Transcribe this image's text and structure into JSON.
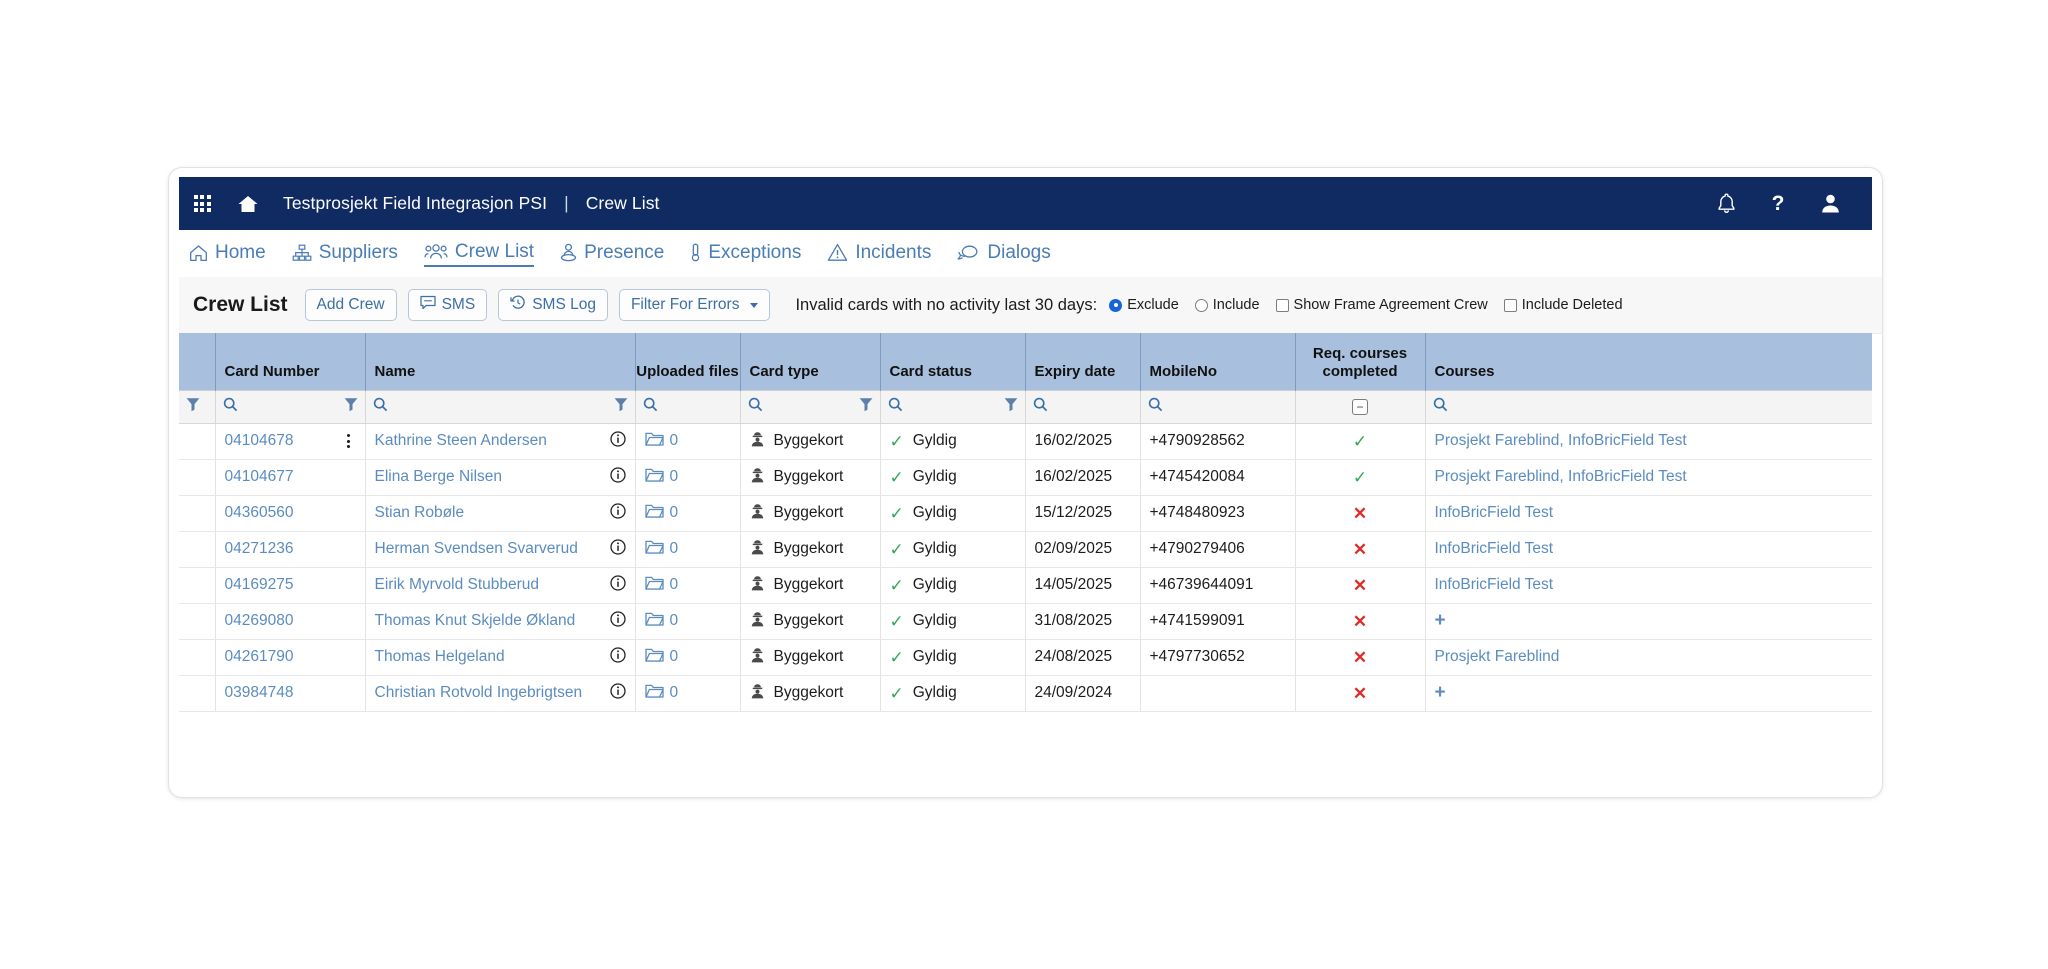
{
  "topbar": {
    "apps_icon": "grid-apps-icon",
    "home_icon": "home-icon",
    "project": "Testprosjekt Field Integrasjon PSI",
    "separator": "|",
    "page": "Crew List",
    "bell_icon": "notification-bell-icon",
    "help_icon": "help-question-icon",
    "user_icon": "user-avatar-icon",
    "bg_color": "#102a62"
  },
  "nav": {
    "items": [
      {
        "label": "Home",
        "icon": "home-outline-icon",
        "active": false
      },
      {
        "label": "Suppliers",
        "icon": "org-hierarchy-icon",
        "active": false
      },
      {
        "label": "Crew List",
        "icon": "people-group-icon",
        "active": true
      },
      {
        "label": "Presence",
        "icon": "person-location-icon",
        "active": false
      },
      {
        "label": "Exceptions",
        "icon": "thermometer-icon",
        "active": false
      },
      {
        "label": "Incidents",
        "icon": "warning-triangle-icon",
        "active": false
      },
      {
        "label": "Dialogs",
        "icon": "chat-bubbles-icon",
        "active": false
      }
    ],
    "link_color": "#4a7cb5"
  },
  "toolbar": {
    "title": "Crew List",
    "add_crew": "Add Crew",
    "sms": "SMS",
    "sms_log": "SMS Log",
    "filter_for_errors": "Filter For Errors",
    "invalid_label": "Invalid cards with no activity last 30 days:",
    "radio_exclude": "Exclude",
    "radio_include": "Include",
    "radio_selected": "Exclude",
    "check_frame_agreement": "Show Frame Agreement Crew",
    "check_frame_agreement_checked": false,
    "check_include_deleted": "Include Deleted",
    "check_include_deleted_checked": false
  },
  "table": {
    "header_bg": "#a8c0de",
    "columns": [
      {
        "label": "",
        "name": "select-column"
      },
      {
        "label": "Card Number",
        "name": "card-number"
      },
      {
        "label": "Name",
        "name": "name"
      },
      {
        "label": "Uploaded files",
        "name": "uploaded-files"
      },
      {
        "label": "Card type",
        "name": "card-type"
      },
      {
        "label": "Card status",
        "name": "card-status"
      },
      {
        "label": "Expiry date",
        "name": "expiry-date"
      },
      {
        "label": "MobileNo",
        "name": "mobile-no"
      },
      {
        "label": "Req. courses completed",
        "name": "req-courses-completed"
      },
      {
        "label": "Courses",
        "name": "courses"
      }
    ],
    "filter_row": {
      "search_icon": "magnifier-icon",
      "funnel_icon": "filter-funnel-icon",
      "minus_icon": "minus-box-icon"
    },
    "rows": [
      {
        "card_number": "04104678",
        "name": "Kathrine Steen Andersen",
        "uploaded_files": "0",
        "card_type": "Byggekort",
        "card_status": "Gyldig",
        "expiry_date": "16/02/2025",
        "mobile_no": "+4790928562",
        "req_courses_completed": "check",
        "courses": "Prosjekt Fareblind, InfoBricField Test",
        "has_kebab": true
      },
      {
        "card_number": "04104677",
        "name": "Elina Berge Nilsen",
        "uploaded_files": "0",
        "card_type": "Byggekort",
        "card_status": "Gyldig",
        "expiry_date": "16/02/2025",
        "mobile_no": "+4745420084",
        "req_courses_completed": "check",
        "courses": "Prosjekt Fareblind, InfoBricField Test",
        "has_kebab": false
      },
      {
        "card_number": "04360560",
        "name": "Stian Robøle",
        "uploaded_files": "0",
        "card_type": "Byggekort",
        "card_status": "Gyldig",
        "expiry_date": "15/12/2025",
        "mobile_no": "+4748480923",
        "req_courses_completed": "cross",
        "courses": "InfoBricField Test",
        "has_kebab": false
      },
      {
        "card_number": "04271236",
        "name": "Herman Svendsen Svarverud",
        "uploaded_files": "0",
        "card_type": "Byggekort",
        "card_status": "Gyldig",
        "expiry_date": "02/09/2025",
        "mobile_no": "+4790279406",
        "req_courses_completed": "cross",
        "courses": "InfoBricField Test",
        "has_kebab": false
      },
      {
        "card_number": "04169275",
        "name": "Eirik Myrvold Stubberud",
        "uploaded_files": "0",
        "card_type": "Byggekort",
        "card_status": "Gyldig",
        "expiry_date": "14/05/2025",
        "mobile_no": "+46739644091",
        "req_courses_completed": "cross",
        "courses": "InfoBricField Test",
        "has_kebab": false
      },
      {
        "card_number": "04269080",
        "name": "Thomas Knut Skjelde Økland",
        "uploaded_files": "0",
        "card_type": "Byggekort",
        "card_status": "Gyldig",
        "expiry_date": "31/08/2025",
        "mobile_no": "+4741599091",
        "req_courses_completed": "cross",
        "courses": "+",
        "has_kebab": false
      },
      {
        "card_number": "04261790",
        "name": "Thomas Helgeland",
        "uploaded_files": "0",
        "card_type": "Byggekort",
        "card_status": "Gyldig",
        "expiry_date": "24/08/2025",
        "mobile_no": "+4797730652",
        "req_courses_completed": "cross",
        "courses": "Prosjekt Fareblind",
        "has_kebab": false
      },
      {
        "card_number": "03984748",
        "name": "Christian Rotvold Ingebrigtsen",
        "uploaded_files": "0",
        "card_type": "Byggekort",
        "card_status": "Gyldig",
        "expiry_date": "24/09/2024",
        "mobile_no": "",
        "req_courses_completed": "cross",
        "courses": "+",
        "has_kebab": false
      }
    ]
  },
  "colors": {
    "brand_dark": "#102a62",
    "link_blue": "#5b8cc0",
    "header_blue": "#a8c0de",
    "valid_green": "#32a852",
    "error_red": "#e02b2b"
  }
}
